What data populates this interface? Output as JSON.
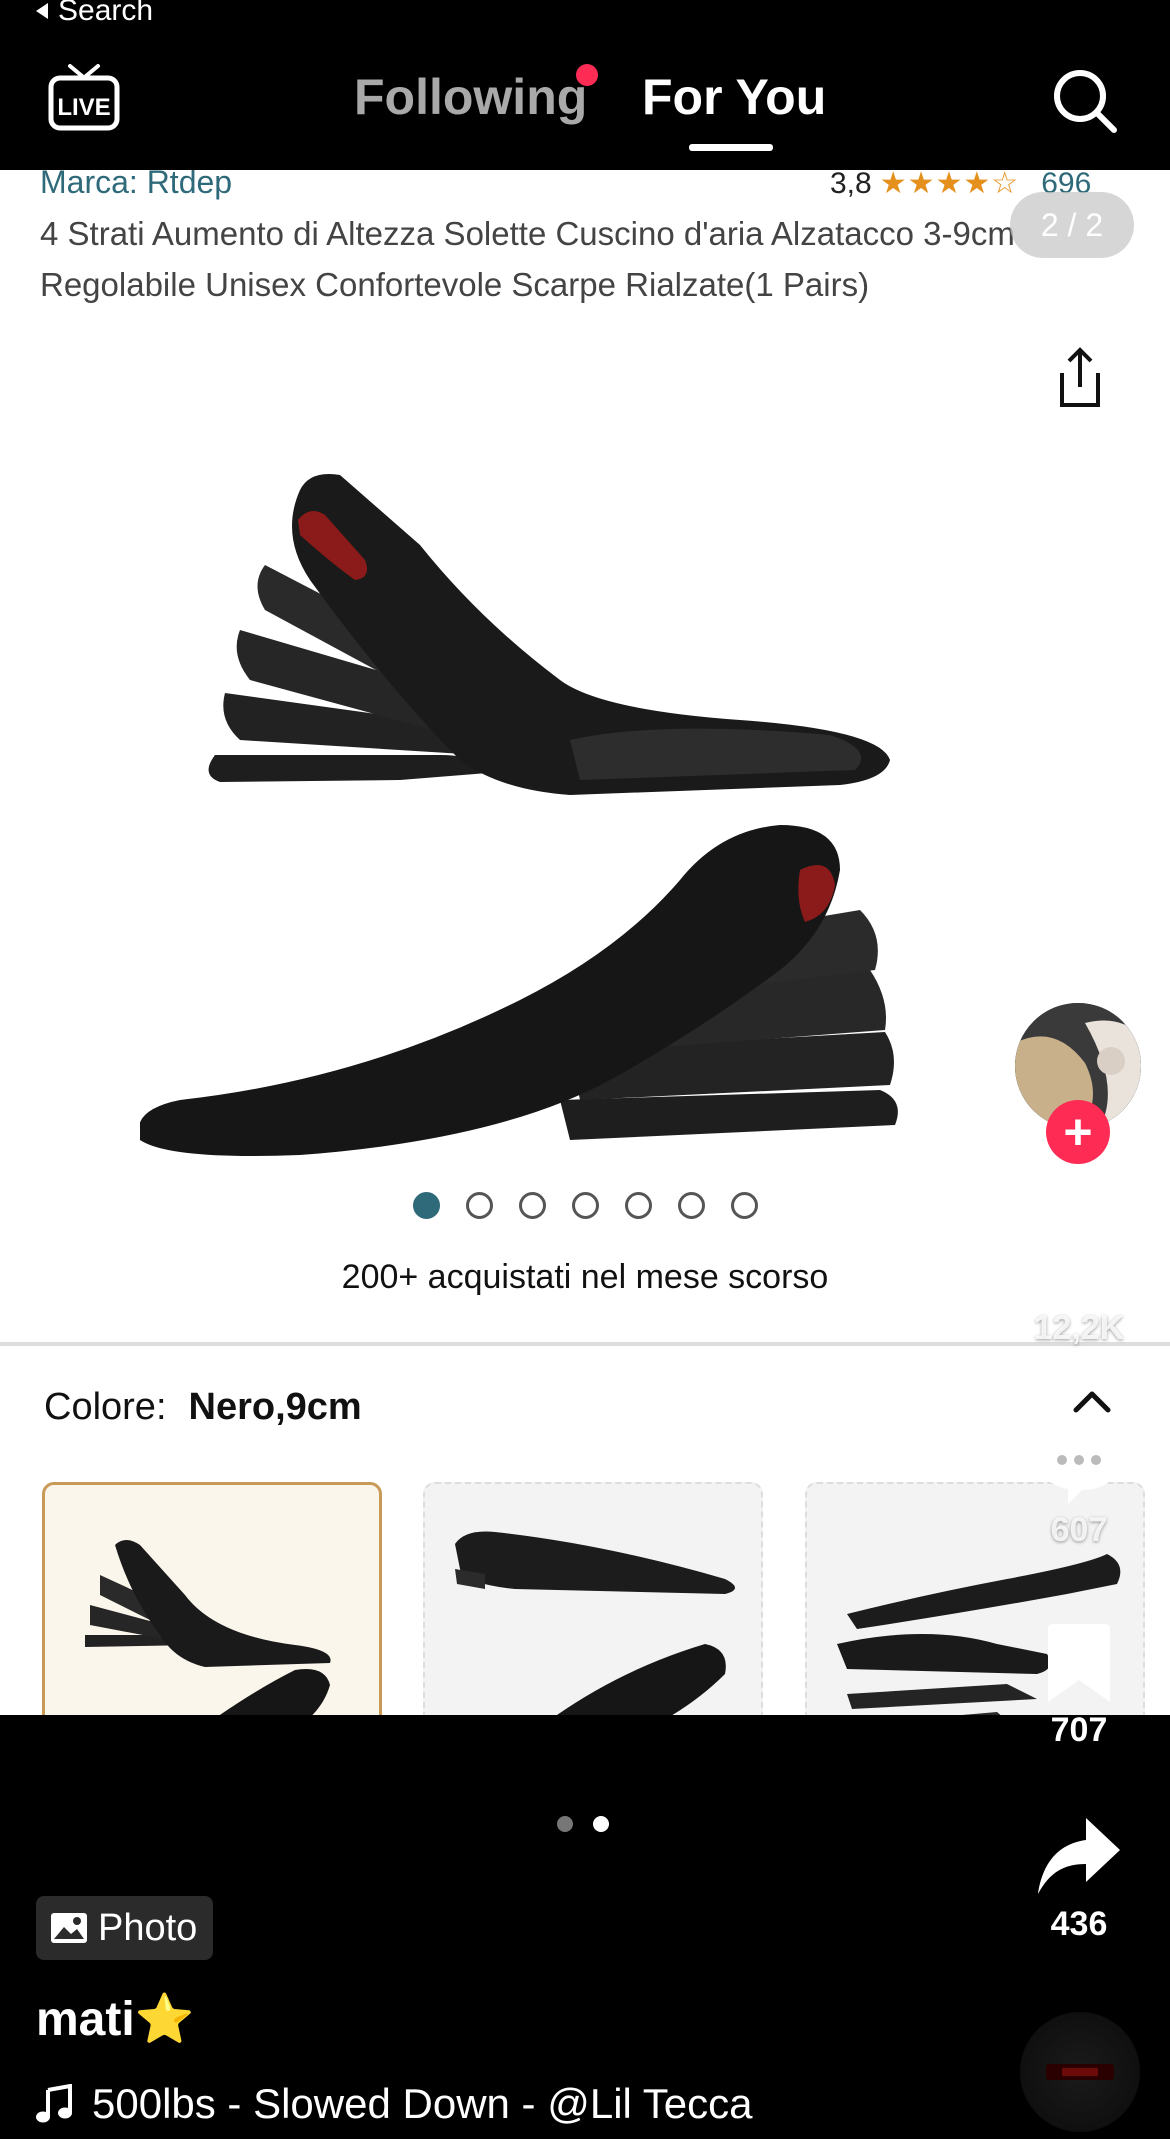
{
  "status": {
    "back_label": "Search"
  },
  "nav": {
    "tabs": [
      {
        "label": "Following",
        "active": false,
        "has_notification_dot": true
      },
      {
        "label": "For You",
        "active": true
      }
    ]
  },
  "product": {
    "brand": "Marca: Rtdep",
    "rating_value": "3,8",
    "rating_count": "696",
    "title": "4 Strati Aumento di Altezza Solette Cuscino d'aria Alzatacco 3-9cm Regolabile Unisex Confortevole Scarpe Rialzate(1 Pairs)",
    "image_counter": "2 / 2",
    "image_dots_count": 7,
    "image_dots_active": 0,
    "bought_text": "200+ acquistati nel mese scorso",
    "color_label": "Colore:",
    "color_value": "Nero,9cm"
  },
  "actions": {
    "likes": "12,2K",
    "comments": "607",
    "saves": "707",
    "shares": "436"
  },
  "post": {
    "page_count": 2,
    "page_active": 1,
    "type_badge": "Photo",
    "username": "mati⭐",
    "music": "500lbs - Slowed Down - @Lil Tecca"
  },
  "colors": {
    "accent_red": "#fe2c55",
    "teal_link": "#2f6a7a",
    "star_orange": "#e58f1c"
  }
}
